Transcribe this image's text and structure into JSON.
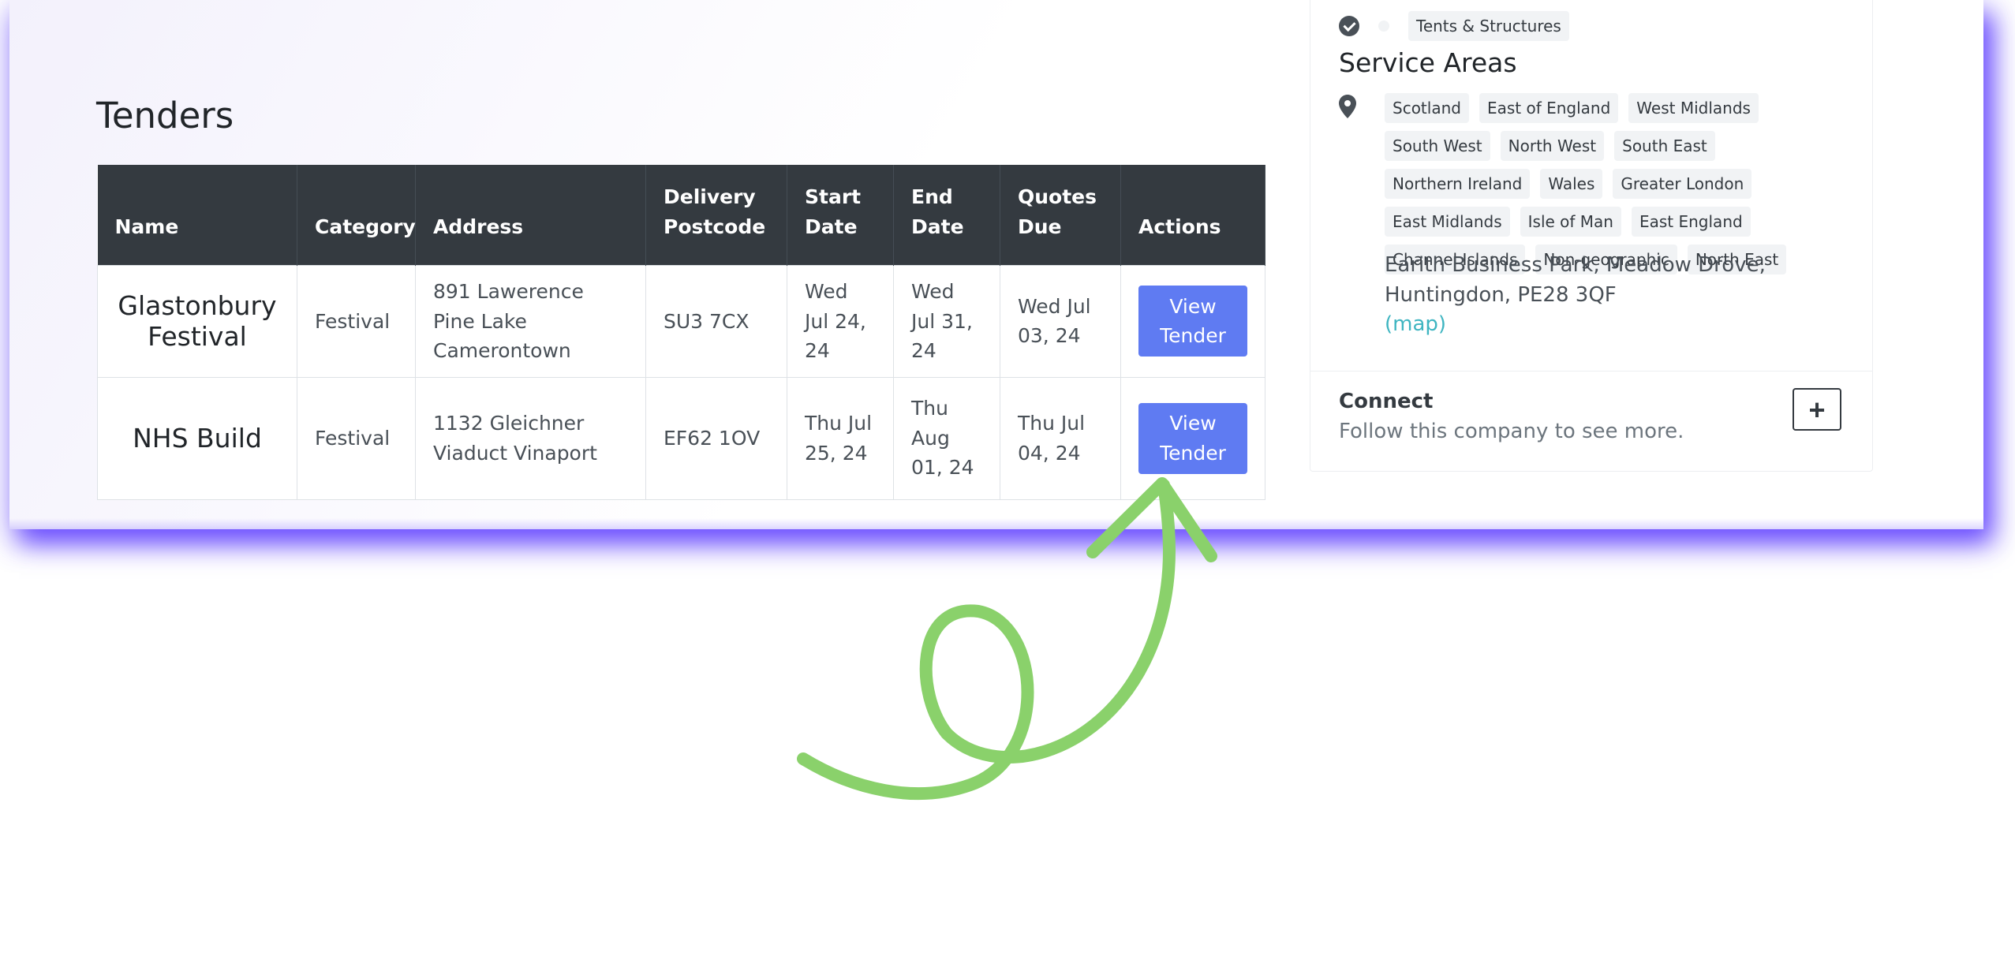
{
  "tenders": {
    "title": "Tenders",
    "columns": [
      "Name",
      "Category",
      "Address",
      "Delivery Postcode",
      "Start Date",
      "End Date",
      "Quotes Due",
      "Actions"
    ],
    "rows": [
      {
        "name": "Glastonbury Festival",
        "category": "Festival",
        "address": "891 Lawerence Pine Lake Camerontown",
        "postcode": "SU3 7CX",
        "start": "Wed Jul 24, 24",
        "end": "Wed Jul 31, 24",
        "quotes_due": "Wed Jul 03, 24",
        "action": "View Tender"
      },
      {
        "name": "NHS Build",
        "category": "Festival",
        "address": "1132 Gleichner Viaduct Vinaport",
        "postcode": "EF62 1OV",
        "start": "Thu Jul 25, 24",
        "end": "Thu Aug 01, 24",
        "quotes_due": "Thu Jul 04, 24",
        "action": "View Tender"
      }
    ]
  },
  "company": {
    "category_tag": "Tents & Structures",
    "service_areas_title": "Service Areas",
    "service_areas": [
      "Scotland",
      "East of England",
      "West Midlands",
      "South West",
      "North West",
      "South East",
      "Northern Ireland",
      "Wales",
      "Greater London",
      "East Midlands",
      "Isle of Man",
      "East England",
      "Channel Islands",
      "Non-geographic",
      "North East"
    ],
    "address": "Earith Business Park, Meadow Drove, Huntingdon, PE28 3QF",
    "map_link": "(map)",
    "connect_title": "Connect",
    "connect_sub": "Follow this company to see more.",
    "connect_button": "+"
  },
  "colors": {
    "accent_button": "#5f7bf2",
    "table_header": "#343a40",
    "arrow": "#8ad16b",
    "shadow": "#6648ff"
  },
  "icons": [
    "check-circle-icon",
    "map-pin-icon",
    "plus-icon",
    "arrow-annotation"
  ]
}
